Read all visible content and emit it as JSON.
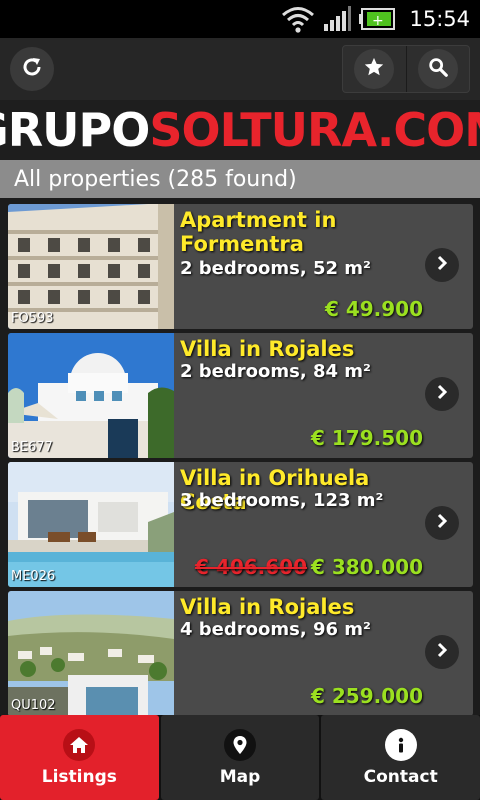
{
  "status_bar": {
    "time": "15:54",
    "icons": [
      "wifi-icon",
      "signal-icon",
      "battery-icon"
    ]
  },
  "action_bar": {
    "icons": [
      "refresh-icon",
      "star-icon",
      "search-icon"
    ]
  },
  "logo": {
    "part1": "GRUPO",
    "part2": "SOLTURA.COM"
  },
  "results": {
    "label": "All properties (285 found)"
  },
  "colors": {
    "accent": "#e3212b",
    "title": "#ffea2a",
    "price": "#9be020",
    "old_price": "#e8242c"
  },
  "listings": [
    {
      "ref": "FO593",
      "title": "Apartment in Formentra",
      "details": "2 bedrooms, 52 m²",
      "price": "€ 49.900",
      "old_price": ""
    },
    {
      "ref": "BE677",
      "title": "Villa in Rojales",
      "details": "2 bedrooms, 84 m²",
      "price": "€ 179.500",
      "old_price": ""
    },
    {
      "ref": "ME026",
      "title": "Villa in Orihuela Costa",
      "details": "3 bedrooms, 123 m²",
      "price": "€ 380.000",
      "old_price": "€ 406.600"
    },
    {
      "ref": "QU102",
      "title": "Villa in Rojales",
      "details": "4 bedrooms, 96 m²",
      "price": "€ 259.000",
      "old_price": ""
    }
  ],
  "nav": [
    {
      "label": "Listings",
      "icon": "home-icon",
      "active": true
    },
    {
      "label": "Map",
      "icon": "map-pin-icon",
      "active": false
    },
    {
      "label": "Contact",
      "icon": "info-icon",
      "active": false
    }
  ]
}
